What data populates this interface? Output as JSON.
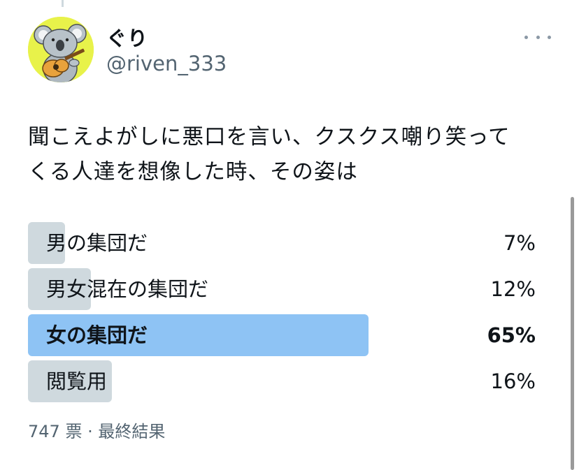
{
  "author": {
    "display_name": "ぐり",
    "handle": "@riven_333",
    "avatar_icon": "koala-with-guitar-avatar"
  },
  "tweet": {
    "text_line1": "聞こえよがしに悪口を言い、クスクス嘲り笑って",
    "text_line2": "くる人達を想像した時、その姿は"
  },
  "poll": {
    "options": [
      {
        "label": "男の集団だ",
        "percent_text": "7%",
        "percent": 7,
        "winner": false
      },
      {
        "label": "男女混在の集団だ",
        "percent_text": "12%",
        "percent": 12,
        "winner": false
      },
      {
        "label": "女の集団だ",
        "percent_text": "65%",
        "percent": 65,
        "winner": true
      },
      {
        "label": "閲覧用",
        "percent_text": "16%",
        "percent": 16,
        "winner": false
      }
    ],
    "votes_text": "747 票 · 最終結果"
  },
  "colors": {
    "bar_default": "#cfd9de",
    "bar_winner": "#8ec3f4",
    "secondary_text": "#536471"
  }
}
